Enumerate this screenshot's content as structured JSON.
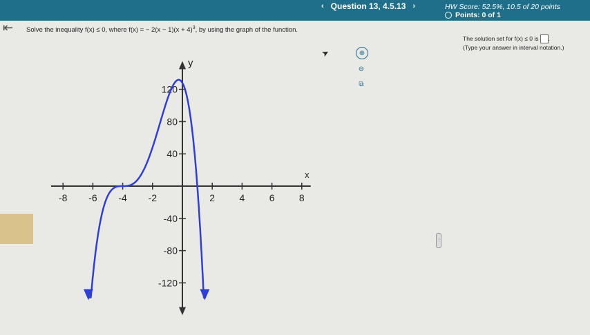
{
  "topbar": {
    "prev_label": "‹",
    "question_label": "Question 13, 4.5.13",
    "next_label": "›",
    "hw_score": "HW Score: 52.5%, 10.5 of 20 points",
    "points": "Points: 0 of 1"
  },
  "back_icon": "⇤",
  "question": {
    "prefix": "Solve the inequality f(x) ≤ 0, where f(x) = − 2(x − 1)(x + 4)",
    "exponent": "3",
    "suffix": ", by using the graph of the function."
  },
  "tools": {
    "zoom_in_icon": "⊕",
    "zoom_out_icon": "⊖",
    "popout_icon": "⧉"
  },
  "answer": {
    "line1": "The solution set for f(x) ≤ 0 is",
    "line2": "(Type your answer in interval notation.)"
  },
  "divider_label": "⋮",
  "chart_data": {
    "type": "line",
    "title": "",
    "xlabel": "x",
    "ylabel": "y",
    "xlim": [
      -9,
      9
    ],
    "ylim": [
      -140,
      140
    ],
    "x_ticks": [
      -8,
      -6,
      -4,
      -2,
      2,
      4,
      6,
      8
    ],
    "y_ticks": [
      -120,
      -80,
      -40,
      40,
      80,
      120
    ],
    "x_tick_labels": [
      "-8",
      "-6",
      "-4",
      "-2",
      "2",
      "4",
      "6",
      "8"
    ],
    "y_tick_labels": [
      "-120",
      "-80",
      "-40",
      "40",
      "80",
      "120"
    ],
    "series": [
      {
        "color": "#2f3fd6",
        "function": "-2(x-1)(x+4)^3",
        "x_range": [
          -6.3,
          1.5
        ]
      }
    ],
    "colors": {
      "curve": "#2f3fd6",
      "axes": "#333333"
    }
  }
}
